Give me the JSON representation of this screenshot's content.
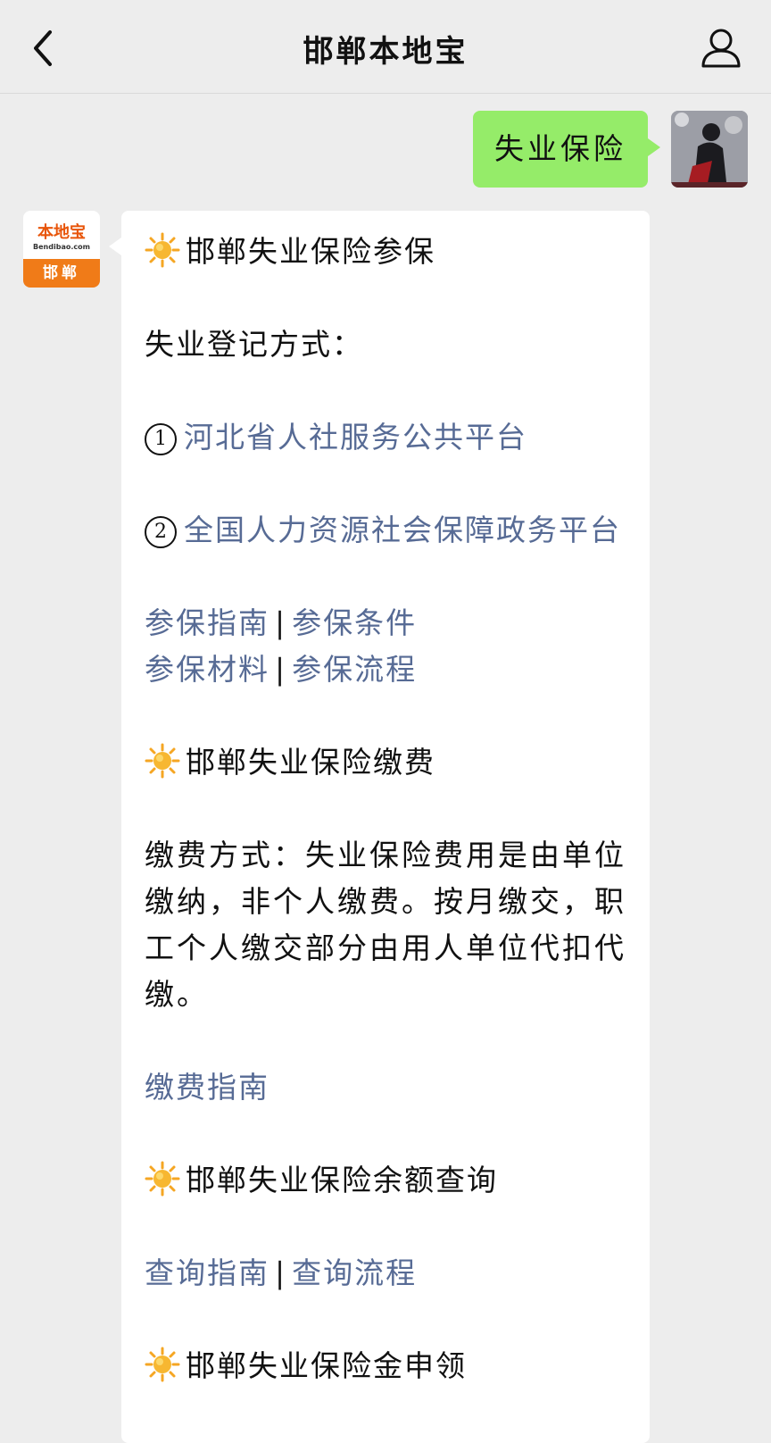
{
  "header": {
    "title": "邯郸本地宝",
    "back_icon": "chevron-left-icon",
    "profile_icon": "user-icon"
  },
  "user_message": {
    "text": "失业保险"
  },
  "bot_avatar": {
    "brand_text": "本地宝",
    "domain_text": "Bendibao.com",
    "city_text": "邯郸"
  },
  "bot_message": {
    "section1": {
      "title": "邯郸失业保险参保",
      "label": "失业登记方式：",
      "option1_num": "1",
      "option1_link": "河北省人社服务公共平台",
      "option2_num": "2",
      "option2_link": "全国人力资源社会保障政务平台",
      "links_row1": [
        "参保指南",
        "参保条件"
      ],
      "links_row2": [
        "参保材料",
        "参保流程"
      ]
    },
    "section2": {
      "title": "邯郸失业保险缴费",
      "paragraph": "缴费方式：失业保险费用是由单位缴纳，非个人缴费。按月缴交，职工个人缴交部分由用人单位代扣代缴。",
      "link": "缴费指南"
    },
    "section3": {
      "title": "邯郸失业保险余额查询",
      "links": [
        "查询指南",
        "查询流程"
      ]
    },
    "section4": {
      "title": "邯郸失业保险金申领"
    },
    "separator": "|"
  },
  "colors": {
    "background": "#ededed",
    "user_bubble": "#95ec69",
    "bot_bubble": "#ffffff",
    "link": "#576b95",
    "brand_orange": "#f07b18"
  }
}
